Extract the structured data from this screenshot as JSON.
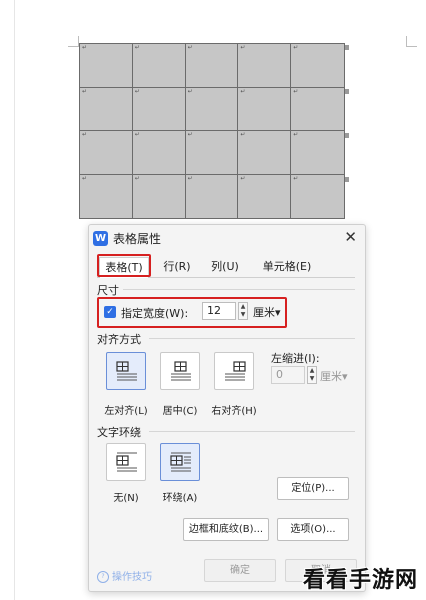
{
  "dialog": {
    "title": "表格属性",
    "app_icon": "W",
    "close_glyph": "✕",
    "tabs": [
      "表格(T)",
      "行(R)",
      "列(U)",
      "单元格(E)"
    ],
    "size_section": "尺寸",
    "width_label": "指定宽度(W):",
    "width_value": "12",
    "width_unit": "厘米▾",
    "align_section": "对齐方式",
    "align_options": [
      "左对齐(L)",
      "居中(C)",
      "右对齐(H)"
    ],
    "indent_label": "左缩进(I):",
    "indent_value": "0",
    "indent_unit": "厘米▾",
    "wrap_section": "文字环绕",
    "wrap_options": [
      "无(N)",
      "环绕(A)"
    ],
    "position_button": "定位(P)...",
    "borders_button": "边框和底纹(B)...",
    "options_button": "选项(O)...",
    "tip_text": "操作技巧",
    "ok_button": "确定",
    "cancel_button": "取消"
  },
  "watermark": "看看手游网",
  "icons": {
    "app": "wps-writer-icon",
    "close": "close-icon",
    "checkbox": "checkbox-checked-icon",
    "tip": "help-icon"
  },
  "colors": {
    "accent": "#2f6fe4",
    "highlight": "#d62020",
    "table_fill": "#c6c6c6"
  }
}
